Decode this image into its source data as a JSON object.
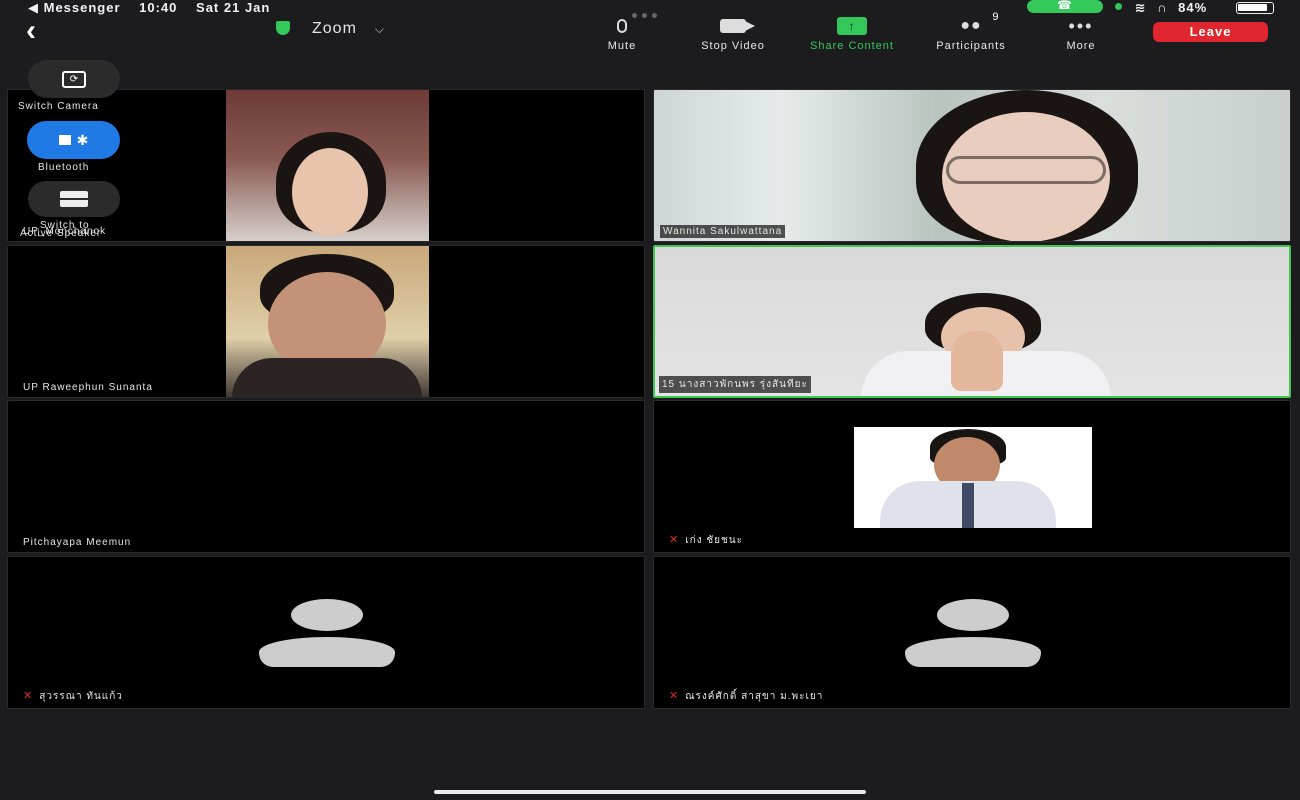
{
  "status_bar": {
    "back_app": "◀ Messenger",
    "time": "10:40",
    "date": "Sat 21 Jan",
    "battery": "84%"
  },
  "toolbar": {
    "title": "Zoom",
    "mute_label": "Mute",
    "stop_video_label": "Stop Video",
    "share_label": "Share Content",
    "participants_label": "Participants",
    "participants_count": "9",
    "more_label": "More",
    "leave_label": "Leave"
  },
  "side_controls": {
    "switch_camera_label": "Switch Camera",
    "bluetooth_label": "Bluetooth",
    "switch_to_label": "Switch to",
    "active_speaker_label": "Active Speaker"
  },
  "participants": [
    {
      "name": "UP_Monchanok",
      "video": true,
      "muted": false
    },
    {
      "name": "Wannita Sakulwattana",
      "video": true,
      "muted": false
    },
    {
      "name": "UP Raweephun Sunanta",
      "video": true,
      "muted": false
    },
    {
      "name": "15 นางสาวพักนพร รุ่งสันทียะ",
      "video": true,
      "muted": false,
      "active": true
    },
    {
      "name": "Pitchayapa Meemun",
      "video": false,
      "muted": false
    },
    {
      "name": "เก่ง ชัยชนะ",
      "video": true,
      "muted": true
    },
    {
      "name": "สุวรรณา ทันแก้ว",
      "video": false,
      "muted": true
    },
    {
      "name": "ณรงค์ศักดิ์ สาสุขา ม.พะเยา",
      "video": false,
      "muted": true
    }
  ],
  "colors": {
    "background": "#1c1c1e",
    "share_green": "#34c759",
    "leave_red": "#e0262e",
    "active_border": "#3ec650",
    "bluetooth_blue": "#1f7ae6"
  }
}
